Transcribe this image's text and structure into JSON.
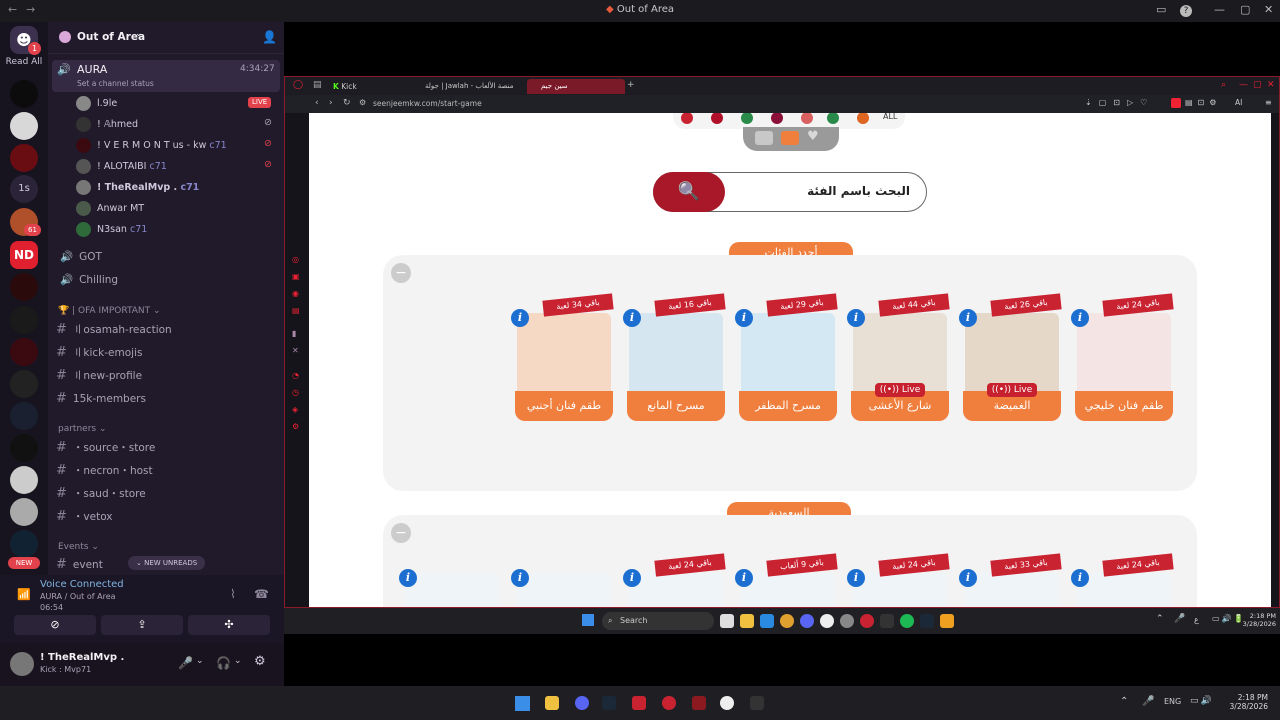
{
  "discord": {
    "window_title": "Out of Area",
    "read_all": "Read All",
    "server_name": "Out of Area",
    "guild_badges": {
      "home": "1",
      "g8": "61",
      "text_guild": "1s",
      "new": "NEW"
    },
    "voice_channel": {
      "name": "AURA",
      "timer": "4:34:27",
      "status": "Set a channel status"
    },
    "voice_users": [
      {
        "name": "l.9le",
        "tag": "LIVE"
      },
      {
        "name": "! 𝔸hmed",
        "tag": ""
      },
      {
        "name": "! V E R M O N T  us - kw",
        "tag": "c71"
      },
      {
        "name": "! ALOTAIBI",
        "tag": "c71"
      },
      {
        "name": "! TheRealMvp .",
        "tag": "c71"
      },
      {
        "name": "Anwar",
        "tag": "MT"
      },
      {
        "name": "N3san",
        "tag": "c71"
      }
    ],
    "channels_top": [
      {
        "name": "GOT"
      },
      {
        "name": "Chilling"
      }
    ],
    "category_important": "| OFA IMPORTANT",
    "text_channels": [
      {
        "name": "〢osamah-reaction"
      },
      {
        "name": "〢kick-emojis"
      },
      {
        "name": "〢new-profile"
      },
      {
        "name": "15k-members"
      }
    ],
    "category_partners": "partners",
    "partner_channels": [
      {
        "name": "・source・store"
      },
      {
        "name": "・necron・host"
      },
      {
        "name": "・saud・store"
      },
      {
        "name": "・vetox"
      }
    ],
    "category_events": "Events",
    "event_channel": "event",
    "new_unreads": "NEW UNREADS",
    "voice_panel": {
      "title": "Voice Connected",
      "where": "AURA / Out of Area",
      "time": "06:54"
    },
    "user_panel": {
      "name": "! TheRealMvp .",
      "status": "Kick : Mvp71"
    }
  },
  "browser": {
    "tabs": [
      {
        "label": "Kick"
      },
      {
        "label": "جولة | Jawlah - منصة الألعاب"
      },
      {
        "label": "سين جيم"
      }
    ],
    "url": "seenjeemkw.com/start-game",
    "ai_label": "AI",
    "all_label": "ALL",
    "search_placeholder": "البحث باسم الفئة",
    "section1_title": "أجدد الفئات",
    "section2_title": "السعودية",
    "cards_row1": [
      {
        "ribbon": "باقي 34 لعبة",
        "label": "طقم فنان أجنبي",
        "live": ""
      },
      {
        "ribbon": "باقي 16 لعبة",
        "label": "مسرح المانع",
        "live": ""
      },
      {
        "ribbon": "باقي 29 لعبة",
        "label": "مسرح المظفر",
        "live": ""
      },
      {
        "ribbon": "باقي 44 لعبة",
        "label": "شارع الأعشى",
        "live": "Live"
      },
      {
        "ribbon": "باقي 26 لعبة",
        "label": "الغميضة",
        "live": "Live"
      },
      {
        "ribbon": "باقي 24 لعبة",
        "label": "طقم فنان خليجي",
        "live": ""
      }
    ],
    "cards_row2": [
      {
        "ribbon": ""
      },
      {
        "ribbon": ""
      },
      {
        "ribbon": "باقي 24 لعبة"
      },
      {
        "ribbon": "باقي 9 ألعاب"
      },
      {
        "ribbon": "باقي 24 لعبة"
      },
      {
        "ribbon": "باقي 33 لعبة"
      },
      {
        "ribbon": "باقي 24 لعبة"
      }
    ]
  },
  "taskbar_inner": {
    "search": "Search",
    "lang": "ع",
    "time": "2:18 PM",
    "date": "3/28/2026"
  },
  "taskbar_outer": {
    "lang": "ENG",
    "time": "2:18 PM",
    "date": "3/28/2026"
  },
  "colors": {
    "accent": "#f07e3c",
    "red": "#c92332",
    "discord_bg": "#201a2b"
  }
}
